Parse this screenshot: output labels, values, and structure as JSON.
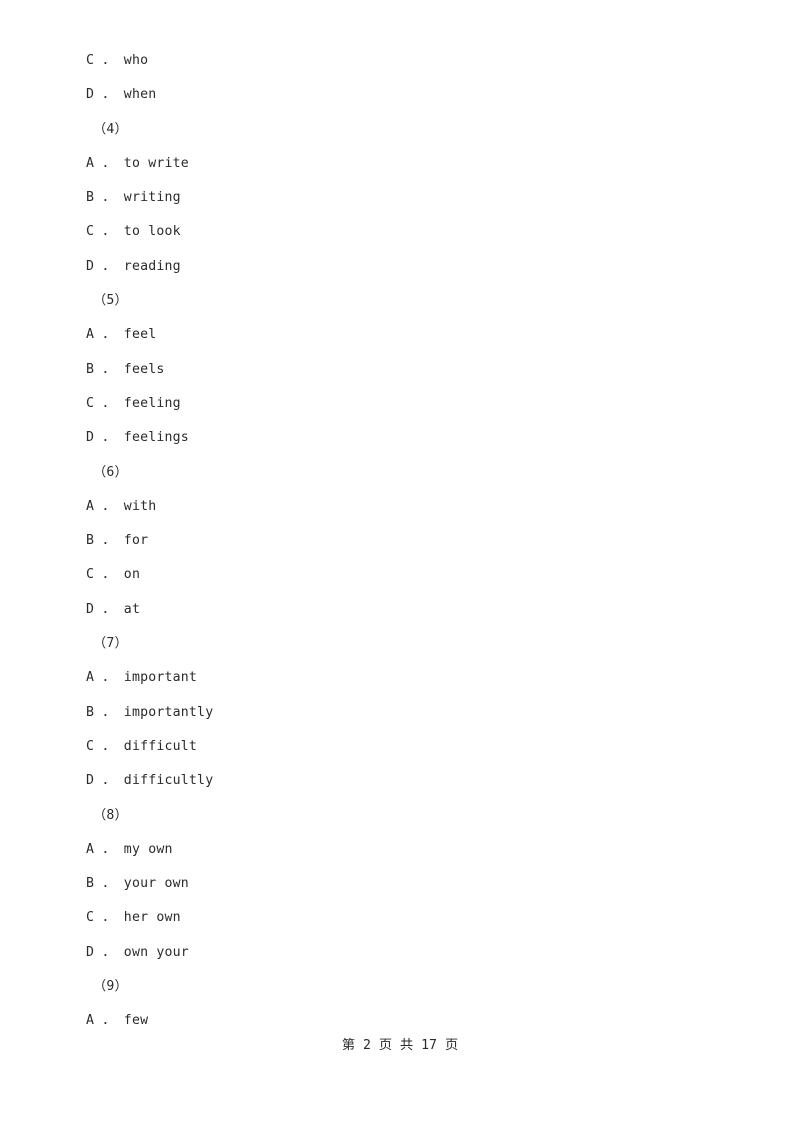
{
  "document": {
    "lines": [
      {
        "kind": "option",
        "letter": "C",
        "separator": "．",
        "text": "who",
        "full": "C ． who"
      },
      {
        "kind": "option",
        "letter": "D",
        "separator": "．",
        "text": "when",
        "full": "D ． when"
      },
      {
        "kind": "question_number",
        "text": "（4）",
        "full": "（4）"
      },
      {
        "kind": "option",
        "letter": "A",
        "separator": "．",
        "text": "to write",
        "full": "A ． to write"
      },
      {
        "kind": "option",
        "letter": "B",
        "separator": "．",
        "text": "writing",
        "full": "B ． writing"
      },
      {
        "kind": "option",
        "letter": "C",
        "separator": "．",
        "text": "to look",
        "full": "C ． to look"
      },
      {
        "kind": "option",
        "letter": "D",
        "separator": "．",
        "text": "reading",
        "full": "D ． reading"
      },
      {
        "kind": "question_number",
        "text": "（5）",
        "full": "（5）"
      },
      {
        "kind": "option",
        "letter": "A",
        "separator": "．",
        "text": "feel",
        "full": "A ． feel"
      },
      {
        "kind": "option",
        "letter": "B",
        "separator": "．",
        "text": "feels",
        "full": "B ． feels"
      },
      {
        "kind": "option",
        "letter": "C",
        "separator": "．",
        "text": "feeling",
        "full": "C ． feeling"
      },
      {
        "kind": "option",
        "letter": "D",
        "separator": "．",
        "text": "feelings",
        "full": "D ． feelings"
      },
      {
        "kind": "question_number",
        "text": "（6）",
        "full": "（6）"
      },
      {
        "kind": "option",
        "letter": "A",
        "separator": "．",
        "text": "with",
        "full": "A ． with"
      },
      {
        "kind": "option",
        "letter": "B",
        "separator": "．",
        "text": "for",
        "full": "B ． for"
      },
      {
        "kind": "option",
        "letter": "C",
        "separator": "．",
        "text": "on",
        "full": "C ． on"
      },
      {
        "kind": "option",
        "letter": "D",
        "separator": "．",
        "text": "at",
        "full": "D ． at"
      },
      {
        "kind": "question_number",
        "text": "（7）",
        "full": "（7）"
      },
      {
        "kind": "option",
        "letter": "A",
        "separator": "．",
        "text": "important",
        "full": "A ． important"
      },
      {
        "kind": "option",
        "letter": "B",
        "separator": "．",
        "text": "importantly",
        "full": "B ． importantly"
      },
      {
        "kind": "option",
        "letter": "C",
        "separator": "．",
        "text": "difficult",
        "full": "C ． difficult"
      },
      {
        "kind": "option",
        "letter": "D",
        "separator": "．",
        "text": "difficultly",
        "full": "D ． difficultly"
      },
      {
        "kind": "question_number",
        "text": "（8）",
        "full": "（8）"
      },
      {
        "kind": "option",
        "letter": "A",
        "separator": "．",
        "text": "my own",
        "full": "A ． my own"
      },
      {
        "kind": "option",
        "letter": "B",
        "separator": "．",
        "text": "your own",
        "full": "B ． your own"
      },
      {
        "kind": "option",
        "letter": "C",
        "separator": "．",
        "text": "her own",
        "full": "C ． her own"
      },
      {
        "kind": "option",
        "letter": "D",
        "separator": "．",
        "text": "own your",
        "full": "D ． own your"
      },
      {
        "kind": "question_number",
        "text": "（9）",
        "full": "（9）"
      },
      {
        "kind": "option",
        "letter": "A",
        "separator": "．",
        "text": "few",
        "full": "A ． few"
      }
    ]
  },
  "footer": {
    "page_label": "第 2 页 共 17 页",
    "current_page": "2",
    "total_pages": "17"
  },
  "colors": {
    "page_background": "#ffffff",
    "text": "#2b2b2b"
  }
}
